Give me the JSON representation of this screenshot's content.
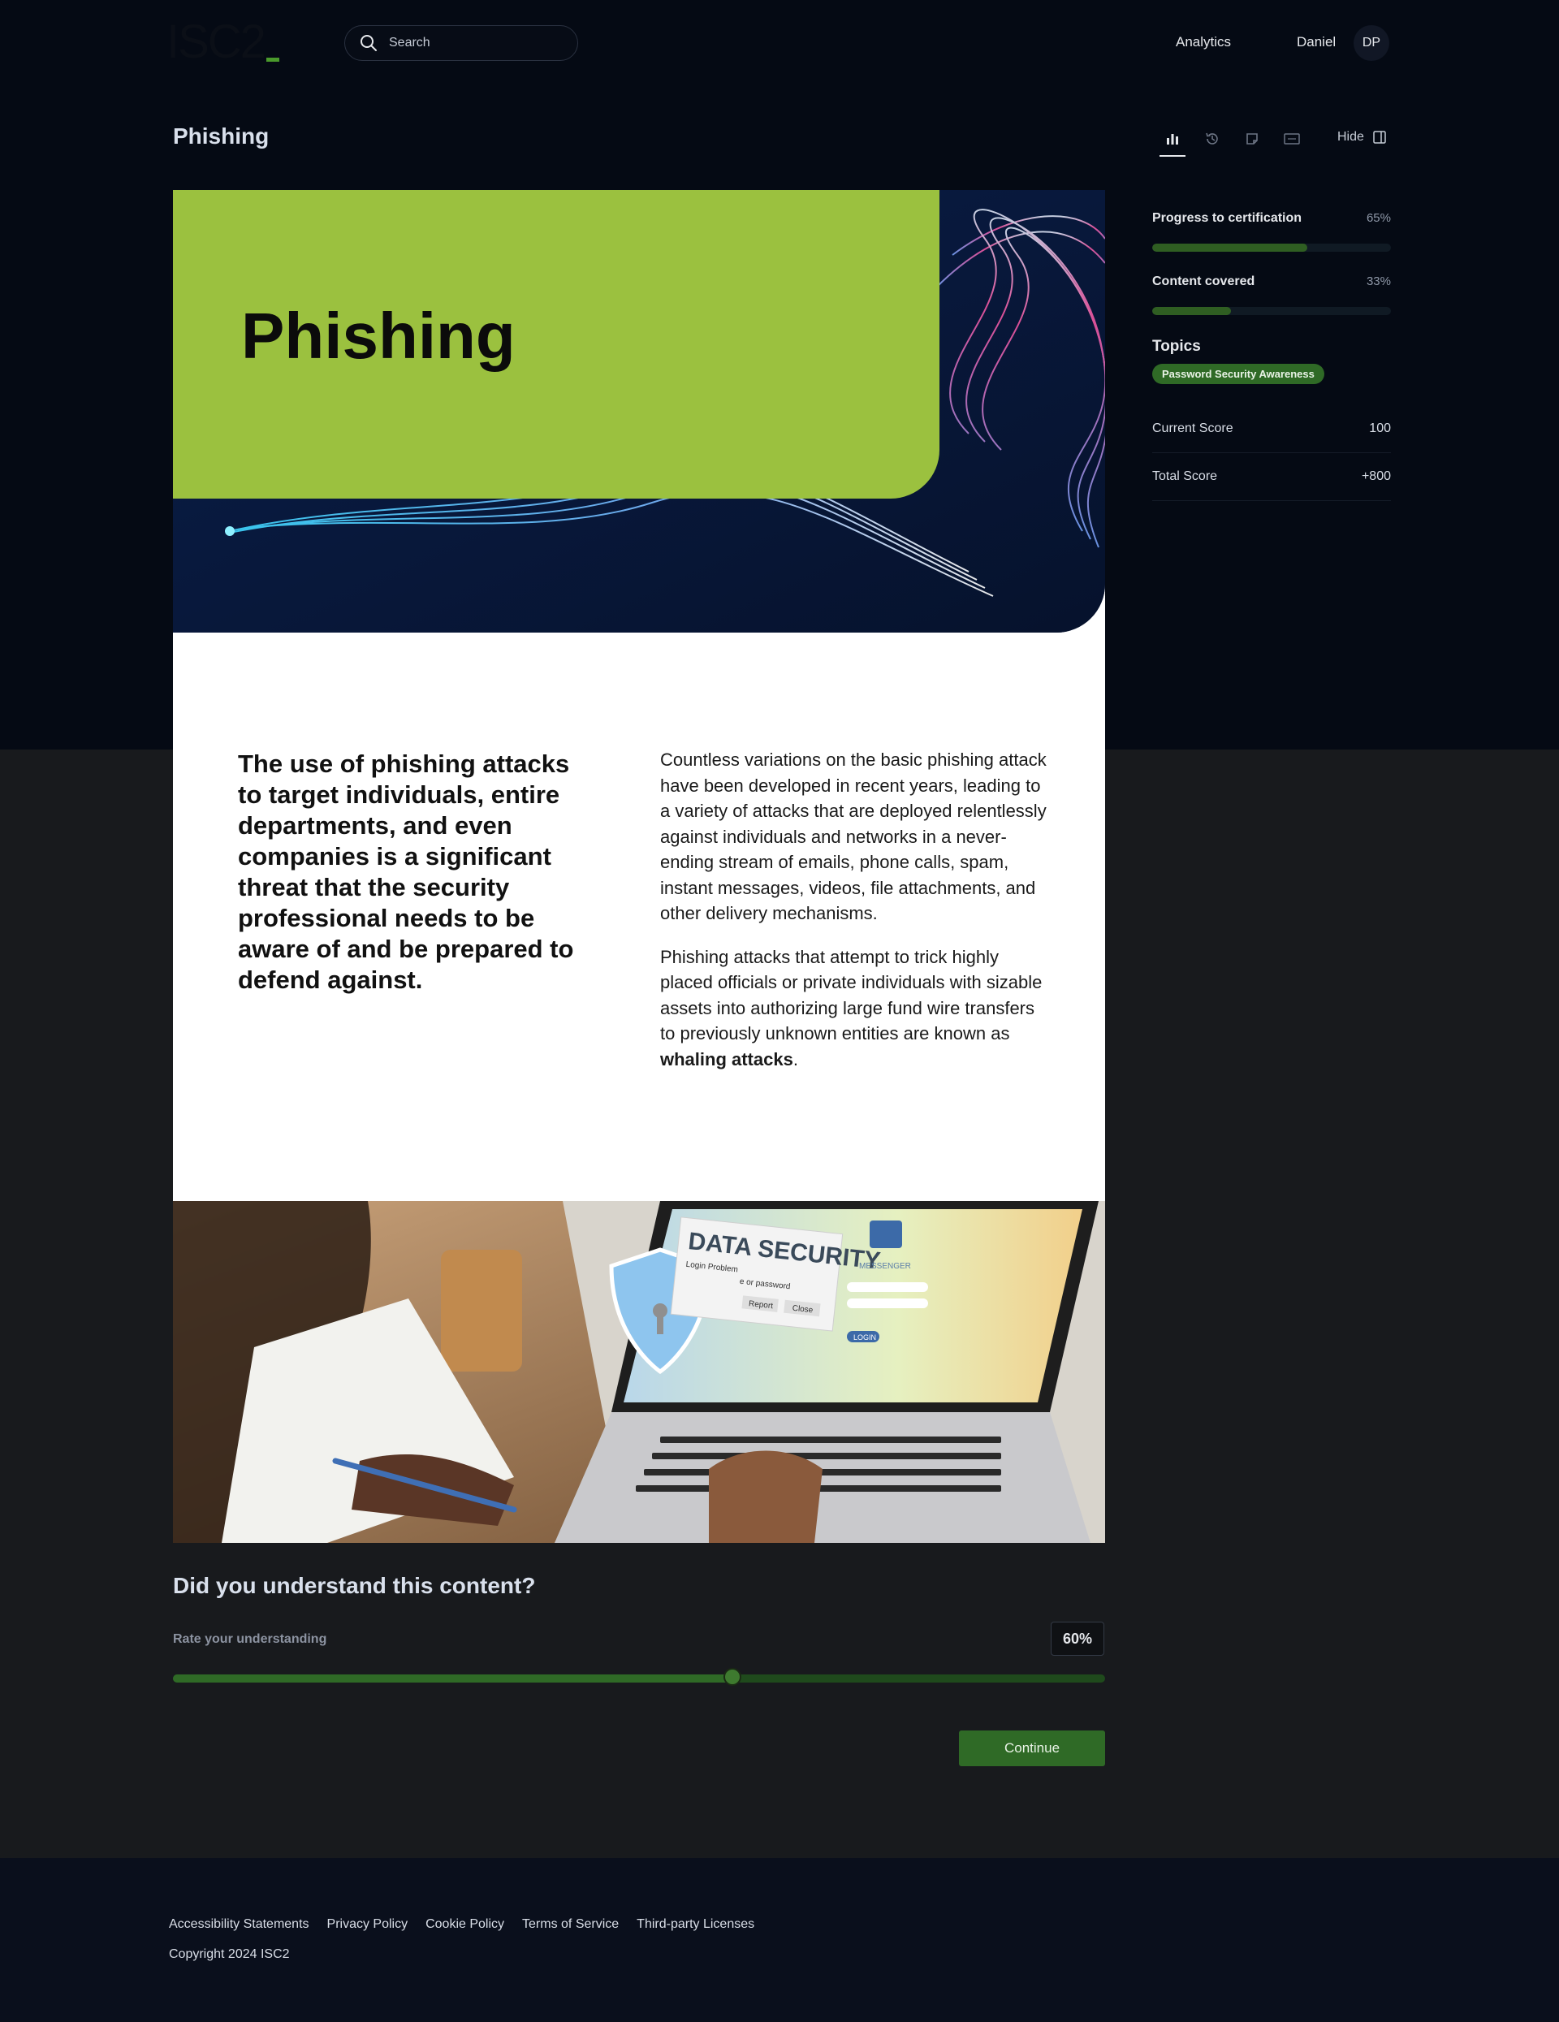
{
  "header": {
    "logo": "ISC2",
    "search_placeholder": "Search",
    "nav_analytics": "Analytics",
    "user_name": "Daniel",
    "avatar_initials": "DP"
  },
  "page": {
    "title": "Phishing",
    "hide_label": "Hide"
  },
  "sidebar": {
    "progress_label": "Progress to certification",
    "progress_value": "65%",
    "progress_fraction": 0.65,
    "content_label": "Content covered",
    "content_value": "33%",
    "content_fraction": 0.33,
    "topics_heading": "Topics",
    "topic_chip": "Password Security Awareness",
    "current_score_label": "Current Score",
    "current_score_value": "100",
    "total_score_label": "Total Score",
    "total_score_value": "+800"
  },
  "content": {
    "hero_title": "Phishing",
    "lead": "The use of phishing attacks to target individuals, entire departments, and even companies is a significant threat that the security professional needs to be aware of and be prepared to defend against.",
    "para1": "Countless variations on the basic phishing attack have been developed in recent years, leading to a variety of attacks that are deployed relentlessly against individuals and networks in a never-ending stream of emails, phone calls, spam, instant messages, videos, file attachments, and other delivery mechanisms.",
    "para2_start": "Phishing attacks that attempt to trick highly placed officials or private individuals with sizable assets into authorizing large fund wire transfers to previously unknown entities are known as ",
    "para2_bold": "whaling attacks",
    "para2_end": ".",
    "photo_text_title": "DATA SECURITY",
    "photo_text_sub": "Login Problem",
    "photo_text_pw": "e or password",
    "photo_btn_report": "Report",
    "photo_btn_close": "Close",
    "photo_messenger": "MESSENGER",
    "photo_login": "LOGIN"
  },
  "feedback": {
    "question": "Did you understand this content?",
    "rate_label": "Rate your understanding",
    "rate_value": "60%",
    "rate_fraction": 0.6,
    "continue_label": "Continue"
  },
  "footer": {
    "links": [
      "Accessibility Statements",
      "Privacy Policy",
      "Cookie Policy",
      "Terms of Service",
      "Third-party Licenses"
    ],
    "copyright": "Copyright 2024 ISC2"
  },
  "colors": {
    "accent_green": "#2f6a26",
    "hero_green": "#9bc13f",
    "background_dark": "#050a14"
  }
}
